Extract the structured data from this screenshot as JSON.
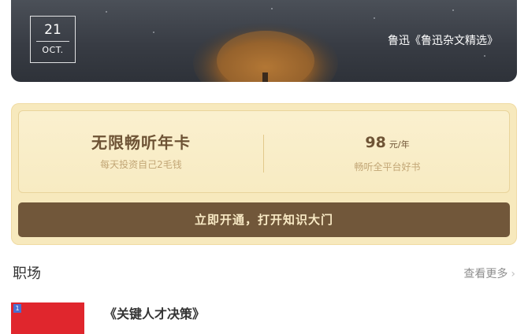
{
  "banner": {
    "day": "21",
    "month": "OCT.",
    "quote_source": "鲁迅《鲁迅杂文精选》"
  },
  "vip_card": {
    "title": "无限畅听年卡",
    "subtitle": "每天投资自己2毛钱",
    "price": "98",
    "price_unit": "元/年",
    "price_subtitle": "畅听全平台好书",
    "cta_label": "立即开通，打开知识大门"
  },
  "section": {
    "title": "职场",
    "more_label": "查看更多"
  },
  "book": {
    "badge": "1",
    "title": "《关键人才决策》"
  },
  "colors": {
    "card_bg": "#f7e9bd",
    "button_bg": "#71573a",
    "cover_red": "#e0262d"
  }
}
